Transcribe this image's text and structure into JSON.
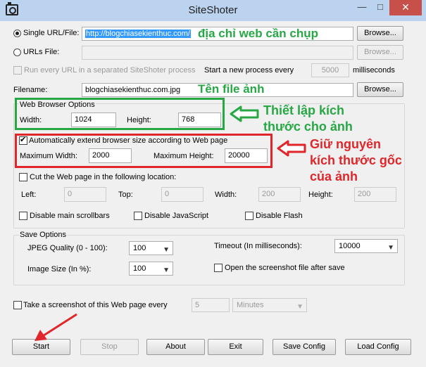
{
  "window": {
    "title": "SiteShoter",
    "minimize": "—",
    "maximize": "□",
    "close": "✕"
  },
  "source": {
    "single_url_label": "Single URL/File:",
    "single_url_value": "http://blogchiasekienthuc.com/",
    "urls_file_label": "URLs File:",
    "browse_label": "Browse...",
    "separate_process_label": "Run every URL in a separated SiteShoter process",
    "start_process_label": "Start a new process every",
    "process_interval": "5000",
    "milliseconds_label": "milliseconds",
    "filename_label": "Filename:",
    "filename_value": "blogchiasekienthuc.com.jpg"
  },
  "browser_options": {
    "group_label": "Web Browser Options",
    "width_label": "Width:",
    "width_value": "1024",
    "height_label": "Height:",
    "height_value": "768",
    "auto_extend_label": "Automatically extend browser size according to Web page",
    "max_width_label": "Maximum Width:",
    "max_width_value": "2000",
    "max_height_label": "Maximum Height:",
    "max_height_value": "20000",
    "cut_label": "Cut the Web page in the following location:",
    "left_label": "Left:",
    "left_value": "0",
    "top_label": "Top:",
    "top_value": "0",
    "cut_width_label": "Width:",
    "cut_width_value": "200",
    "cut_height_label": "Height:",
    "cut_height_value": "200",
    "disable_scrollbars_label": "Disable main scrollbars",
    "disable_js_label": "Disable JavaScript",
    "disable_flash_label": "Disable Flash"
  },
  "save_options": {
    "group_label": "Save Options",
    "jpeg_quality_label": "JPEG Quality (0 - 100):",
    "jpeg_quality_value": "100",
    "image_size_label": "Image Size (In %):",
    "image_size_value": "100",
    "timeout_label": "Timeout (In milliseconds):",
    "timeout_value": "10000",
    "open_after_save_label": "Open the screenshot file after save"
  },
  "schedule": {
    "take_every_label": "Take a screenshot of this Web page every",
    "interval_value": "5",
    "unit_value": "Minutes"
  },
  "buttons": {
    "start": "Start",
    "stop": "Stop",
    "about": "About",
    "exit": "Exit",
    "save_config": "Save Config",
    "load_config": "Load Config"
  },
  "annotations": {
    "url_note": "địa chỉ web cần chụp",
    "filename_note": "Tên file ảnh",
    "size_note_line1": "Thiết lập kích",
    "size_note_line2": "thước cho ảnh",
    "keep_note_line1": "Giữ nguyên",
    "keep_note_line2": "kích thước gốc",
    "keep_note_line3": "của ảnh",
    "colors": {
      "green": "#27a845",
      "red": "#e0262a",
      "blue": "#2c3a8a"
    }
  }
}
